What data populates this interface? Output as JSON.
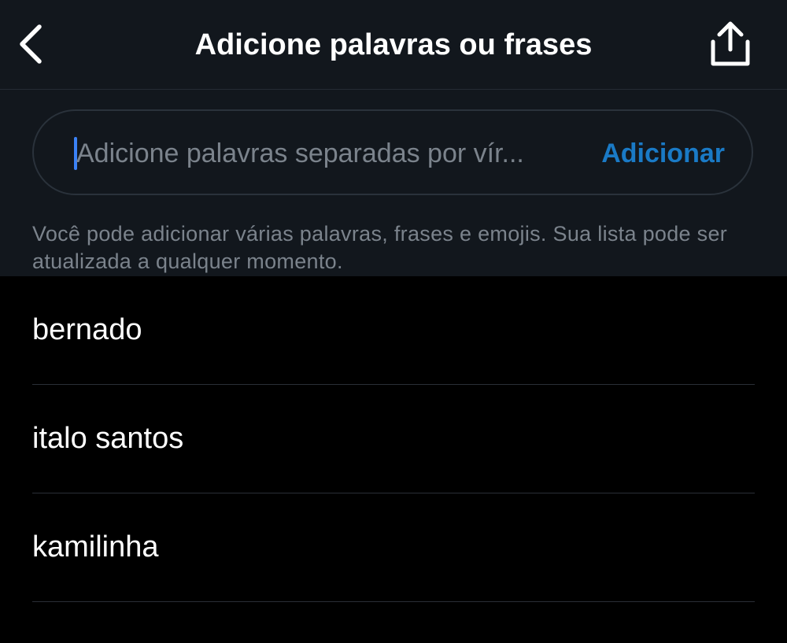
{
  "header": {
    "title": "Adicione palavras ou frases",
    "back_icon": "chevron-left-icon",
    "share_icon": "share-upload-icon"
  },
  "search": {
    "placeholder": "Adicione palavras separadas por vír...",
    "value": "",
    "add_label": "Adicionar"
  },
  "helper_text": "Você pode adicionar várias palavras, frases e emojis. Sua lista pode ser atualizada a qualquer momento.",
  "words": [
    "bernado",
    "italo santos",
    "kamilinha"
  ],
  "colors": {
    "background": "#000000",
    "panel": "#12171d",
    "accent": "#1a7ac6",
    "caret": "#3b82f6",
    "muted_text": "#7b838c"
  }
}
